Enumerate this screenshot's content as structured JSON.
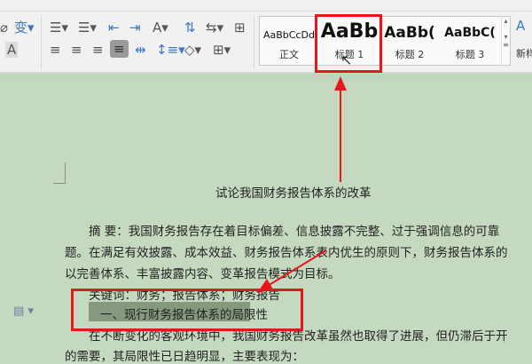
{
  "ribbon": {
    "styles": [
      {
        "preview": "AaBbCcDd",
        "name": "正文"
      },
      {
        "preview": "AaBb",
        "name": "标题 1"
      },
      {
        "preview": "AaBb(",
        "name": "标题 2"
      },
      {
        "preview": "AaBbC(",
        "name": "标题 3"
      }
    ],
    "new_style_label": "新样"
  },
  "document": {
    "title": "试论我国财务报告体系的改革",
    "lines": [
      "摘  要：我国财务报告存在着目标偏差、信息披露不完整、过于强调信息的可靠",
      "题。在满足有效披露、成本效益、财务报告体系表内优生的原则下，财务报告体系的",
      "以完善体系、丰富披露内容、变革报告模式为目标。",
      "关键词：财务；报告体系；财务报告",
      "在不断变化的客观环境中，我国财务报告改革虽然也取得了进展，但仍滞后于开",
      "的需要，其局限性已日趋明显，主要表现为："
    ],
    "heading": "一、现行财务报告体系的局限性"
  },
  "colors": {
    "annotation": "#e8161b",
    "page": "#c5d9c0"
  }
}
